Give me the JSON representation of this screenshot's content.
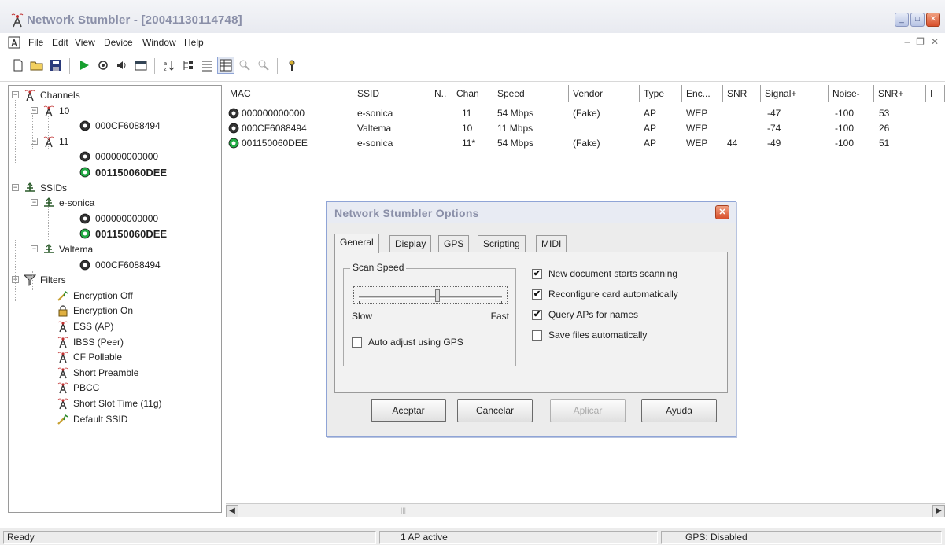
{
  "window": {
    "title": "Network Stumbler - [20041130114748]"
  },
  "menu": [
    "File",
    "Edit",
    "View",
    "Device",
    "Window",
    "Help"
  ],
  "tree": {
    "channels": {
      "label": "Channels",
      "groups": [
        {
          "label": "10",
          "items": [
            {
              "label": "000CF6088494",
              "bold": false,
              "status": "black"
            }
          ]
        },
        {
          "label": "11",
          "items": [
            {
              "label": "000000000000",
              "bold": false,
              "status": "black"
            },
            {
              "label": "001150060DEE",
              "bold": true,
              "status": "green"
            }
          ]
        }
      ]
    },
    "ssids": {
      "label": "SSIDs",
      "groups": [
        {
          "label": "e-sonica",
          "items": [
            {
              "label": "000000000000",
              "bold": false,
              "status": "black"
            },
            {
              "label": "001150060DEE",
              "bold": true,
              "status": "green"
            }
          ]
        },
        {
          "label": "Valtema",
          "items": [
            {
              "label": "000CF6088494",
              "bold": false,
              "status": "black"
            }
          ]
        }
      ]
    },
    "filters": {
      "label": "Filters",
      "items": [
        "Encryption Off",
        "Encryption On",
        "ESS (AP)",
        "IBSS (Peer)",
        "CF Pollable",
        "Short Preamble",
        "PBCC",
        "Short Slot Time (11g)",
        "Default SSID"
      ]
    }
  },
  "list": {
    "columns": [
      "MAC",
      "SSID",
      "N..",
      "Chan",
      "Speed",
      "Vendor",
      "Type",
      "Enc...",
      "SNR",
      "Signal+",
      "Noise-",
      "SNR+",
      "I"
    ],
    "rows": [
      {
        "mac": "000000000000",
        "ssid": "e-sonica",
        "chan": "11",
        "speed": "54 Mbps",
        "vendor": "(Fake)",
        "type": "AP",
        "enc": "WEP",
        "snr": "",
        "signal": "-47",
        "noise": "-100",
        "snrplus": "53",
        "status": "black"
      },
      {
        "mac": "000CF6088494",
        "ssid": "Valtema",
        "chan": "10",
        "speed": "11 Mbps",
        "vendor": "",
        "type": "AP",
        "enc": "WEP",
        "snr": "",
        "signal": "-74",
        "noise": "-100",
        "snrplus": "26",
        "status": "black"
      },
      {
        "mac": "001150060DEE",
        "ssid": "e-sonica",
        "chan": "11*",
        "speed": "54 Mbps",
        "vendor": "(Fake)",
        "type": "AP",
        "enc": "WEP",
        "snr": "44",
        "signal": "-49",
        "noise": "-100",
        "snrplus": "51",
        "status": "green"
      }
    ]
  },
  "dialog": {
    "title": "Network Stumbler Options",
    "tabs": [
      "General",
      "Display",
      "GPS",
      "Scripting",
      "MIDI"
    ],
    "active_tab": "General",
    "scan_speed": {
      "legend": "Scan Speed",
      "min_label": "Slow",
      "max_label": "Fast",
      "level": 0.55
    },
    "checkboxes": [
      {
        "label": "New document starts scanning",
        "checked": true
      },
      {
        "label": "Reconfigure card automatically",
        "checked": true
      },
      {
        "label": "Query APs for names",
        "checked": true
      },
      {
        "label": "Save files automatically",
        "checked": false
      }
    ],
    "auto_adjust": {
      "label": "Auto adjust using GPS",
      "checked": false
    },
    "buttons": {
      "ok": "Aceptar",
      "cancel": "Cancelar",
      "apply": "Aplicar",
      "help": "Ayuda"
    }
  },
  "status": {
    "ready": "Ready",
    "ap_active": "1 AP active",
    "gps": "GPS: Disabled"
  },
  "colors": {
    "status_green": "#22aa44",
    "title_text": "#8a8fa8",
    "dialog_border": "#8fa4d6"
  }
}
